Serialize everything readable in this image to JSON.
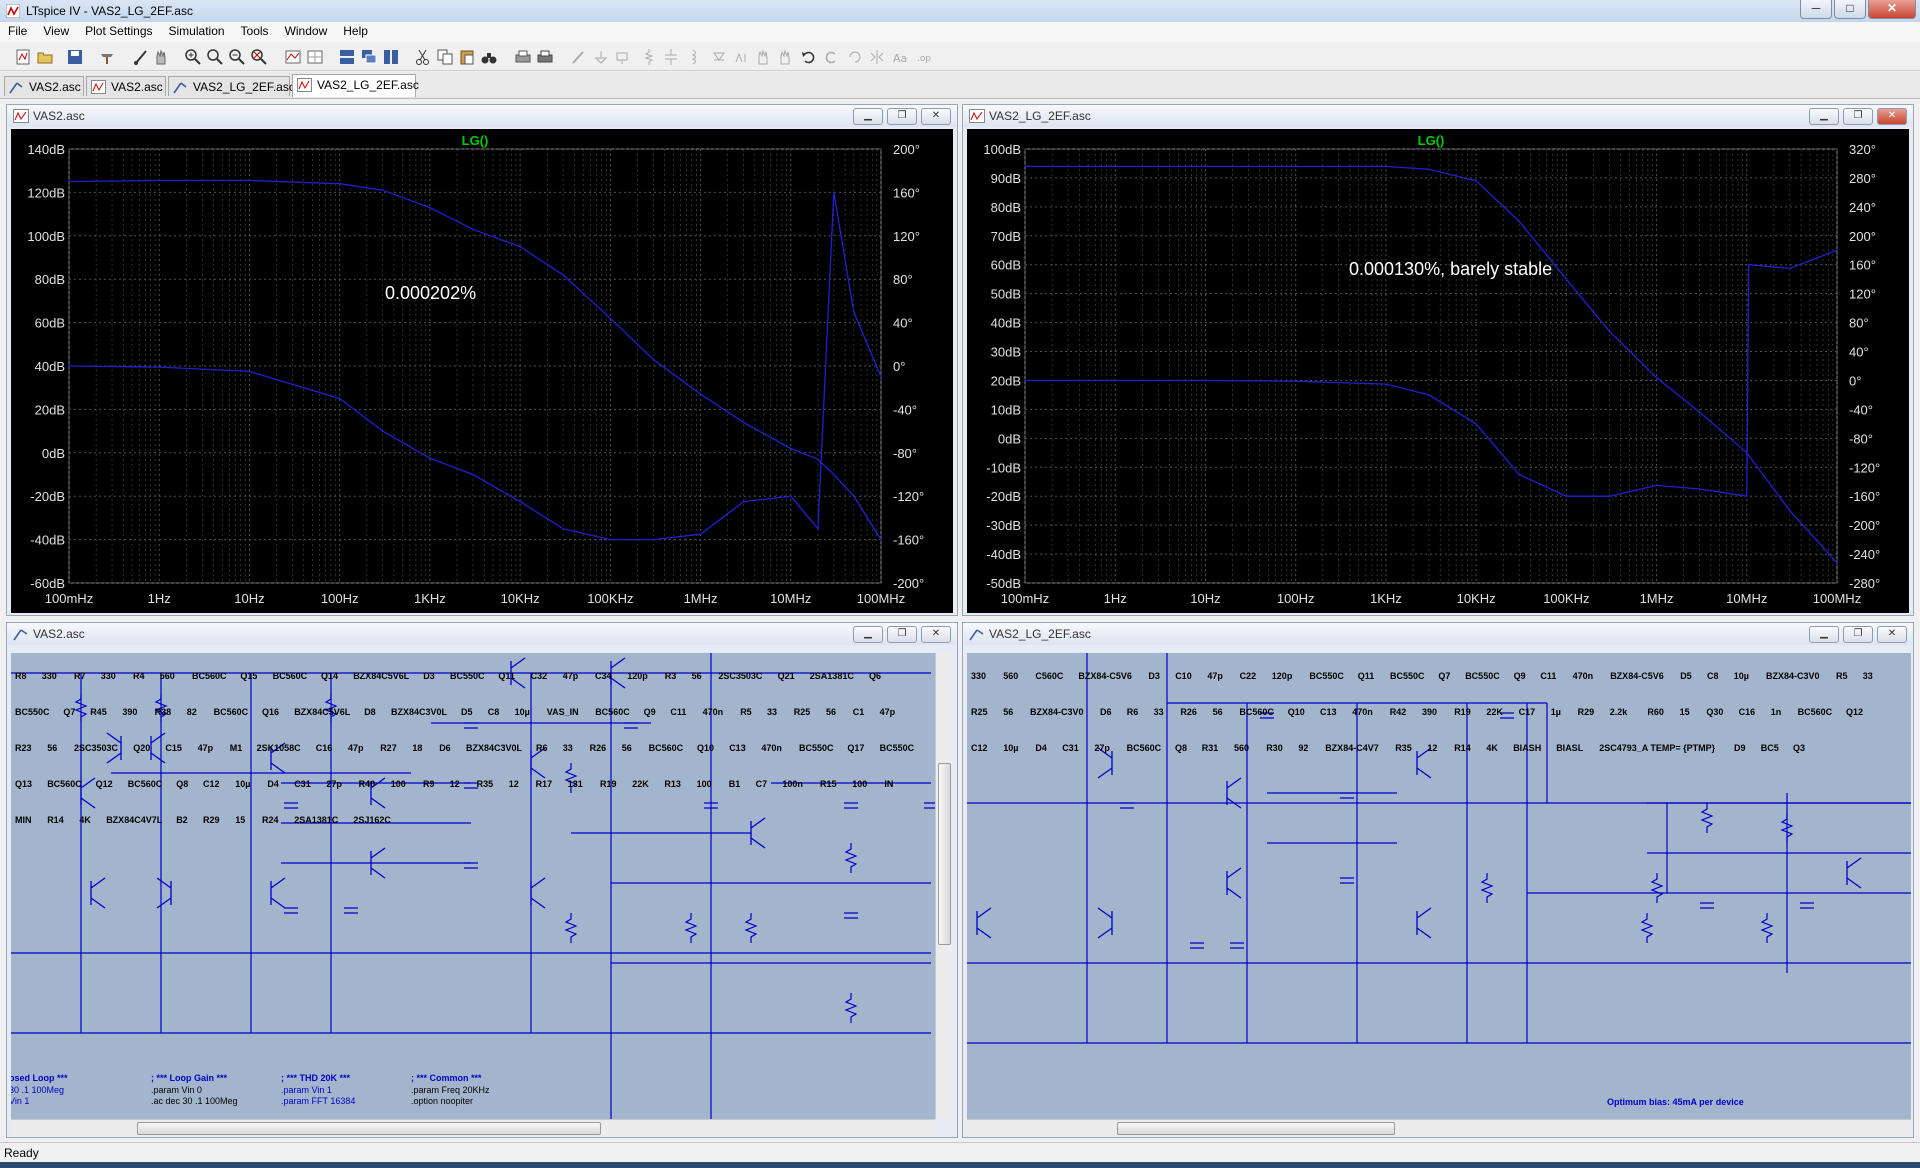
{
  "app": {
    "title": "LTspice IV - VAS2_LG_2EF.asc",
    "window_buttons": {
      "minimize": "─",
      "maximize": "□",
      "close": "✕"
    }
  },
  "menu": [
    "File",
    "View",
    "Plot Settings",
    "Simulation",
    "Tools",
    "Window",
    "Help"
  ],
  "tabs": [
    {
      "label": "VAS2.asc",
      "icon": "schematic-icon",
      "active": false
    },
    {
      "label": "VAS2.asc",
      "icon": "waveform-icon",
      "active": false
    },
    {
      "label": "VAS2_LG_2EF.asc",
      "icon": "schematic-icon",
      "active": false
    },
    {
      "label": "VAS2_LG_2EF.asc",
      "icon": "waveform-icon",
      "active": true
    }
  ],
  "colors": {
    "trace": "#2020d0",
    "trace_label": "#00cc00",
    "grid": "#505050",
    "schematic_bg": "#a3b5cc",
    "wire": "#0000c8"
  },
  "plots": [
    {
      "window_title": "VAS2.asc",
      "trace_label": "LG()",
      "annotation": "0.000202%",
      "y_ticks": [
        "140dB",
        "120dB",
        "100dB",
        "80dB",
        "60dB",
        "40dB",
        "20dB",
        "0dB",
        "-20dB",
        "-40dB",
        "-60dB"
      ],
      "phase_ticks": [
        "200°",
        "160°",
        "120°",
        "80°",
        "40°",
        "0°",
        "-40°",
        "-80°",
        "-120°",
        "-160°",
        "-200°"
      ],
      "x_ticks": [
        "100mHz",
        "1Hz",
        "10Hz",
        "100Hz",
        "1KHz",
        "10KHz",
        "100KHz",
        "1MHz",
        "10MHz",
        "100MHz"
      ]
    },
    {
      "window_title": "VAS2_LG_2EF.asc",
      "trace_label": "LG()",
      "annotation": "0.000130%, barely stable",
      "y_ticks": [
        "100dB",
        "90dB",
        "80dB",
        "70dB",
        "60dB",
        "50dB",
        "40dB",
        "30dB",
        "20dB",
        "10dB",
        "0dB",
        "-10dB",
        "-20dB",
        "-30dB",
        "-40dB",
        "-50dB"
      ],
      "phase_ticks": [
        "320°",
        "280°",
        "240°",
        "200°",
        "160°",
        "120°",
        "80°",
        "40°",
        "0°",
        "-40°",
        "-80°",
        "-120°",
        "-160°",
        "-200°",
        "-240°",
        "-280°"
      ],
      "x_ticks": [
        "100mHz",
        "1Hz",
        "10Hz",
        "100Hz",
        "1KHz",
        "10KHz",
        "100KHz",
        "1MHz",
        "10MHz",
        "100MHz"
      ]
    }
  ],
  "chart_data": [
    {
      "type": "line",
      "title": "LG()",
      "x_scale": "log",
      "xlim": [
        0.1,
        100000000
      ],
      "ylim": [
        -60,
        140
      ],
      "y2lim": [
        -200,
        200
      ],
      "series": [
        {
          "axis": "magnitude_db",
          "x": [
            0.1,
            1,
            10,
            100,
            300,
            1000,
            3000,
            10000,
            30000,
            100000,
            300000,
            1000000,
            3000000,
            10000000,
            20000000,
            30000000,
            50000000,
            100000000
          ],
          "y": [
            125,
            125.5,
            125.5,
            124,
            121,
            113,
            103,
            95,
            82,
            62,
            43,
            27,
            14,
            2,
            -3,
            -10,
            -20,
            -40
          ]
        },
        {
          "axis": "phase_deg",
          "x": [
            0.1,
            1,
            10,
            100,
            300,
            1000,
            3000,
            10000,
            30000,
            100000,
            300000,
            1000000,
            3000000,
            10000000,
            20000000,
            30000000,
            50000000,
            100000000
          ],
          "y": [
            0,
            -1,
            -5,
            -30,
            -60,
            -85,
            -100,
            -125,
            -150,
            -160,
            -160,
            -155,
            -125,
            -120,
            -150,
            160,
            50,
            -10
          ]
        }
      ]
    },
    {
      "type": "line",
      "title": "LG()",
      "x_scale": "log",
      "xlim": [
        0.1,
        100000000
      ],
      "ylim": [
        -50,
        100
      ],
      "y2lim": [
        -280,
        320
      ],
      "series": [
        {
          "axis": "magnitude_db",
          "x": [
            0.1,
            1,
            10,
            100,
            1000,
            3000,
            10000,
            30000,
            100000,
            300000,
            1000000,
            3000000,
            10000000,
            30000000,
            100000000
          ],
          "y": [
            94,
            94,
            94,
            94,
            94,
            93,
            89,
            75,
            55,
            37,
            21,
            9,
            -5,
            -25,
            -43
          ]
        },
        {
          "axis": "phase_deg",
          "x": [
            0.1,
            1,
            10,
            100,
            1000,
            3000,
            10000,
            30000,
            100000,
            300000,
            1000000,
            3000000,
            10000000,
            10500000,
            30000000,
            100000000
          ],
          "y": [
            0,
            0,
            0,
            -1,
            -5,
            -20,
            -60,
            -130,
            -160,
            -160,
            -145,
            -150,
            -160,
            160,
            155,
            180
          ]
        }
      ]
    }
  ],
  "schematics": [
    {
      "window_title": "VAS2.asc",
      "labels": [
        "R8",
        "330",
        "R7",
        "330",
        "R4",
        "560",
        "BC560C",
        "Q15",
        "BC560C",
        "Q14",
        "BZX84C5V6L",
        "D3",
        "BC550C",
        "Q11",
        "C32",
        "47p",
        "C34",
        "120p",
        "R3",
        "56",
        "2SC3503C",
        "Q21",
        "2SA1381C",
        "Q6",
        "BC550C",
        "Q7",
        "R45",
        "390",
        "R38",
        "82",
        "BC560C",
        "Q16",
        "BZX84C5V6L",
        "D8",
        "BZX84C3V0L",
        "D5",
        "C8",
        "10µ",
        "VAS_IN",
        "BC560C",
        "Q9",
        "C11",
        "470n",
        "R5",
        "33",
        "R25",
        "56",
        "C1",
        "47p",
        "R23",
        "56",
        "2SC3503C",
        "Q20",
        "C15",
        "47p",
        "M1",
        "2SK1058C",
        "C16",
        "47p",
        "R27",
        "18",
        "D6",
        "BZX84C3V0L",
        "R6",
        "33",
        "R26",
        "56",
        "BC560C",
        "Q10",
        "C13",
        "470n",
        "BC550C",
        "Q17",
        "BC550C",
        "Q13",
        "BC560C",
        "Q12",
        "BC560C",
        "Q8",
        "C12",
        "10µ",
        "D4",
        "C31",
        "27p",
        "R40",
        "100",
        "R9",
        "12",
        "R35",
        "12",
        "R17",
        "131",
        "R19",
        "22K",
        "R13",
        "100",
        "B1",
        "C7",
        "100n",
        "R15",
        "100",
        "IN",
        "MIN",
        "R14",
        "4K",
        "BZX84C4V7L",
        "B2",
        "R29",
        "15",
        "R24",
        "2SA1381C",
        "2SJ162C"
      ],
      "directives": [
        {
          "title": "osed Loop ***",
          "lines": [
            "30 .1 100Meg",
            "Vin 1"
          ]
        },
        {
          "title": "; *** Loop Gain ***",
          "lines": [
            ".param Vin 0",
            ".ac dec 30 .1 100Meg"
          ]
        },
        {
          "title": "; *** THD 20K ***",
          "lines": [
            ".param Vin 1",
            ".param FFT 16384"
          ]
        },
        {
          "title": "; *** Common ***",
          "lines": [
            ".param Freq 20KHz",
            ".option noopiter"
          ]
        }
      ]
    },
    {
      "window_title": "VAS2_LG_2EF.asc",
      "labels": [
        "330",
        "560",
        "C560C",
        "BZX84-C5V6",
        "D3",
        "C10",
        "47p",
        "C22",
        "120p",
        "BC550C",
        "Q11",
        "BC550C",
        "Q7",
        "BC550C",
        "Q9",
        "C11",
        "470n",
        "BZX84-C5V6",
        "D5",
        "C8",
        "10µ",
        "BZX84-C3V0",
        "R5",
        "33",
        "R25",
        "56",
        "BZX84-C3V0",
        "D6",
        "R6",
        "33",
        "R26",
        "56",
        "BC560C",
        "Q10",
        "C13",
        "470n",
        "R42",
        "390",
        "R19",
        "22K",
        "C17",
        "1µ",
        "R29",
        "2.2k",
        "R60",
        "15",
        "Q30",
        "C16",
        "1n",
        "BC560C",
        "Q12",
        "C12",
        "10µ",
        "D4",
        "C31",
        "27p",
        "BC560C",
        "Q8",
        "R31",
        "560",
        "R30",
        "92",
        "BZX84-C4V7",
        "R35",
        "12",
        "R14",
        "4K",
        "BIASH",
        "BIASL",
        "2SC4793_A TEMP= {PTMP}",
        "D9",
        "BC5",
        "Q3"
      ],
      "note": "Optimum bias: 45mA per device"
    }
  ],
  "status": "Ready"
}
